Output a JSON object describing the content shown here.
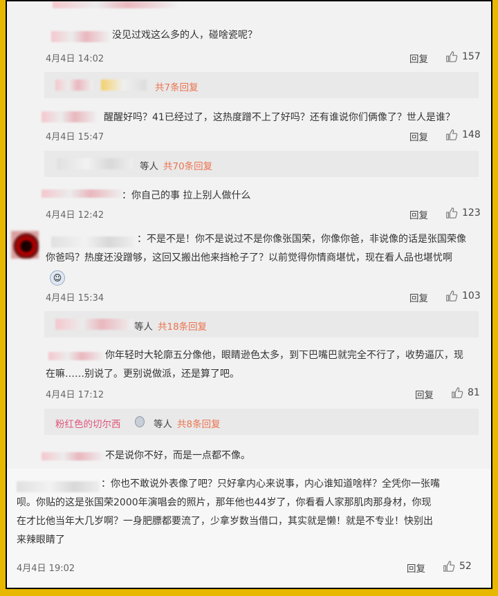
{
  "comments": [
    {
      "text": "没见过戏这么多的人，碰啥瓷呢？",
      "date": "4月4日 14:02",
      "reply": "回复",
      "likes": "157"
    },
    {
      "text": "醒醒好吗？41已经过了，这热度蹭不上了好吗？还有谁说你们俩像了？世人是谁？",
      "date": "4月4日 15:47",
      "reply": "回复",
      "likes": "148"
    },
    {
      "text": "：你自己的事 拉上别人做什么",
      "date": "4月4日 12:42",
      "reply": "回复",
      "likes": "123"
    },
    {
      "line1": "：不是不是！你不是说过不是你像张国荣，你像你爸，非说像的话是张国荣像",
      "line2": "你爸吗？热度还没蹭够，这回又搬出他来挡枪子了？以前觉得你情商堪忧，现在看人品也堪忧啊",
      "date": "4月4日 15:34",
      "reply": "回复",
      "likes": "103"
    },
    {
      "line1": "你年轻时大轮廓五分像他，眼睛逊色太多，到下巴嘴巴就完全不行了，收势逼仄，现",
      "line2": "在嘛……别说了。更别说做派，还是算了吧。",
      "date": "4月4日 17:12",
      "reply": "回复",
      "likes": "81"
    },
    {
      "text": "不是说你不好，而是一点都不像。"
    },
    {
      "line1": "：你也不敢说外表像了吧？只好拿内心来说事，内心谁知道啥样？全凭你一张嘴",
      "line2": "呗。你贴的这是张国荣2000年演唱会的照片，那年他也44岁了，你看看人家那肌肉那身材，你现",
      "line3": "在才比他当年大几岁啊？一身肥膘都要流了，少拿岁数当借口，其实就是懒！就是不专业！快别出",
      "line4": "来辣眼睛了",
      "date": "4月4日 19:02",
      "reply": "回复",
      "likes": "52"
    }
  ],
  "subreplies": [
    {
      "more": "共7条回复"
    },
    {
      "deng": "等人",
      "more": "共70条回复"
    },
    {
      "deng": "等人",
      "more": "共18条回复"
    },
    {
      "name": "粉红色的切尔西",
      "deng": "等人",
      "more": "共8条回复"
    }
  ],
  "icons": {
    "like": "thumbs-up-icon"
  },
  "colors": {
    "accent": "#eb7350",
    "frame": "#e8b800"
  }
}
